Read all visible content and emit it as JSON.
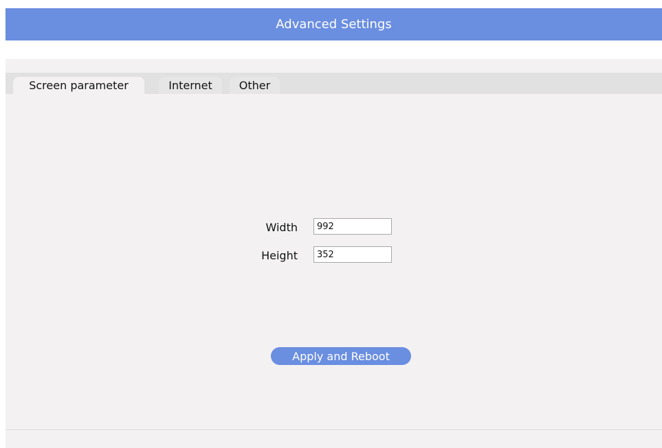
{
  "window": {
    "title": "Advanced Settings"
  },
  "tabs": [
    {
      "label": "Screen parameter",
      "active": true
    },
    {
      "label": "Internet",
      "active": false
    },
    {
      "label": "Other",
      "active": false
    }
  ],
  "screen_parameter": {
    "width_label": "Width",
    "width_value": "992",
    "height_label": "Height",
    "height_value": "352",
    "apply_label": "Apply and Reboot"
  },
  "colors": {
    "accent": "#6a8ee0",
    "panel_background": "#f3f1f2",
    "tab_strip": "#e1e1e1"
  }
}
